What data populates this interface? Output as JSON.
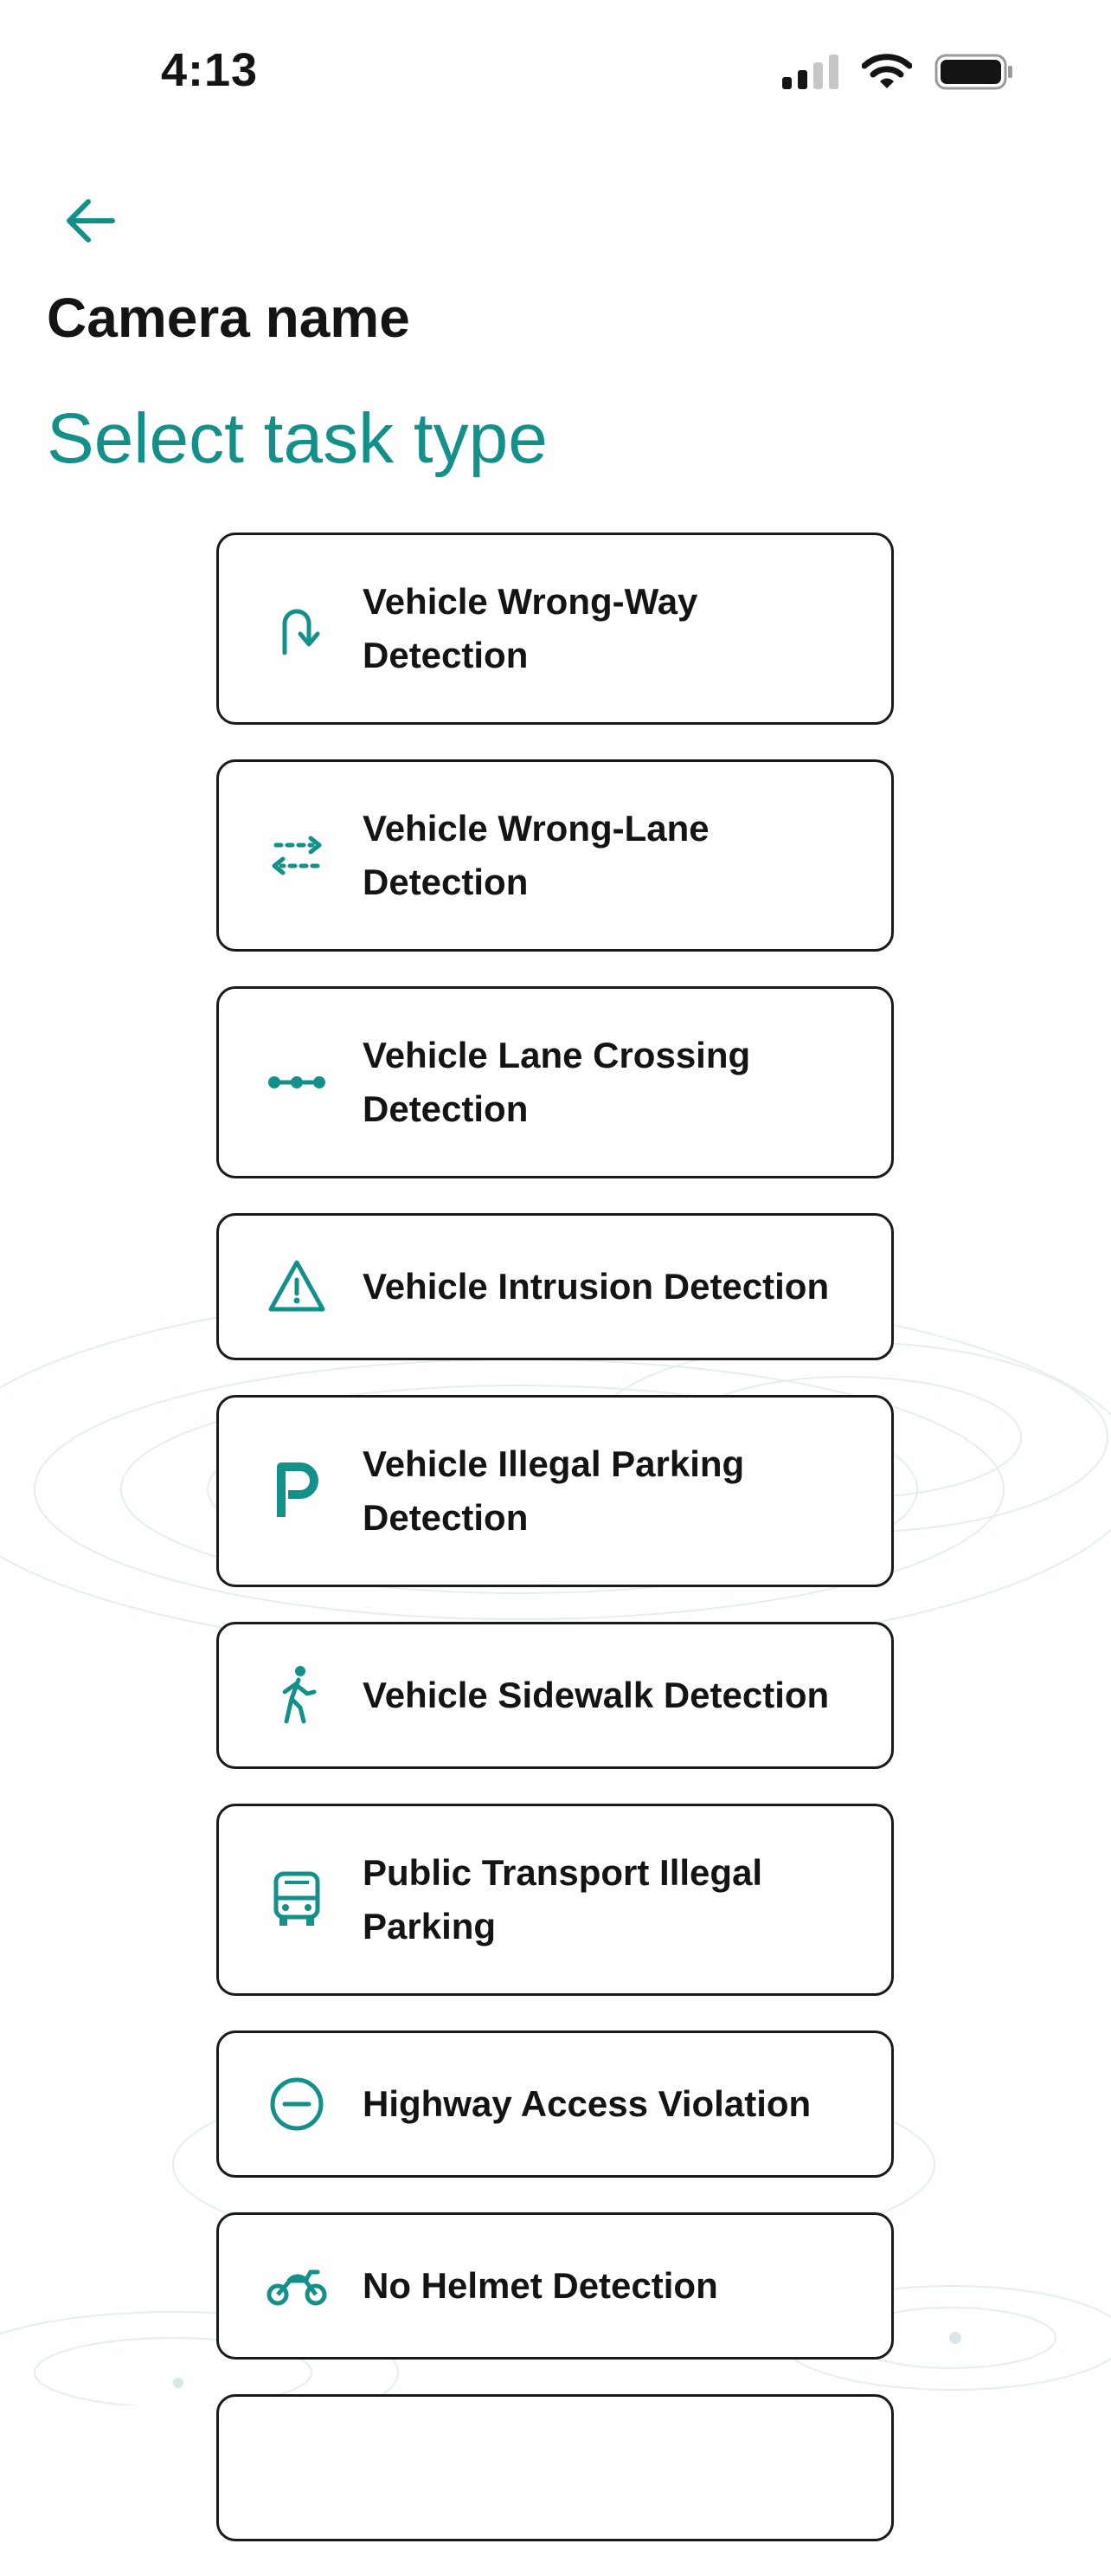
{
  "status_bar": {
    "time": "4:13",
    "icons": [
      "cellular-signal-icon",
      "wifi-icon",
      "battery-icon"
    ]
  },
  "header": {
    "back_icon": "arrow-left-icon",
    "camera_name": "Camera name",
    "title": "Select task type"
  },
  "colors": {
    "accent": "#14908a",
    "text": "#141414",
    "card_border": "#1a1a1a",
    "background": "#ffffff"
  },
  "tasks": [
    {
      "label": "Vehicle Wrong-Way Detection",
      "icon": "u-turn-arrow-icon"
    },
    {
      "label": "Vehicle Wrong-Lane Detection",
      "icon": "swap-lane-arrows-icon"
    },
    {
      "label": "Vehicle Lane Crossing Detection",
      "icon": "dotted-line-icon"
    },
    {
      "label": "Vehicle Intrusion Detection",
      "icon": "warning-triangle-icon"
    },
    {
      "label": "Vehicle Illegal Parking Detection",
      "icon": "parking-p-icon"
    },
    {
      "label": "Vehicle Sidewalk Detection",
      "icon": "pedestrian-walking-icon"
    },
    {
      "label": "Public Transport Illegal Parking",
      "icon": "bus-icon"
    },
    {
      "label": "Highway Access Violation",
      "icon": "no-entry-icon"
    },
    {
      "label": "No Helmet Detection",
      "icon": "motorcycle-icon"
    }
  ]
}
